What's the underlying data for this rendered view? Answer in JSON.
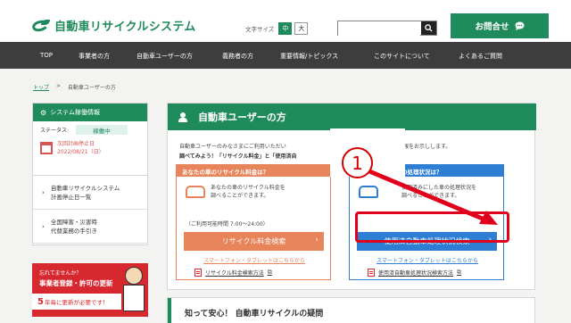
{
  "header": {
    "logo_text": "自動車リサイクルシステム",
    "fontsize_label": "文字サイズ",
    "fontsize_options": [
      "中",
      "大"
    ],
    "search_placeholder": "",
    "contact_label": "お問合せ"
  },
  "nav": {
    "items": [
      "TOP",
      "事業者の方",
      "自動車ユーザーの方",
      "義務者の方",
      "重要情報/トピックス",
      "このサイトについて",
      "よくあるご質問"
    ]
  },
  "breadcrumb": {
    "home": "トップ",
    "separator": ">",
    "current": "自動車ユーザーの方"
  },
  "sidebar": {
    "status_title": "システム稼働情報",
    "status_label": "ステータス:",
    "status_value": "稼働中",
    "maint_line1": "次回計画停止日",
    "maint_line2": "2022/08/21（日）",
    "links": [
      {
        "line1": "自動車リサイクルシステム",
        "line2": "計画停止日一覧"
      },
      {
        "line1": "全国障害・災害時",
        "line2": "代替業務の手引き"
      }
    ],
    "banner_small": "忘れてませんか？",
    "banner_big": "事業者登録・許可の更新",
    "banner_num": "5",
    "banner_strip": "年毎に更新が必要です！"
  },
  "main": {
    "title": "自動車ユーザーの方",
    "intro_part1": "自動車ユーザーのみなさまにご利用いただい",
    "intro_part2": "情報をお示しします。",
    "intro_bold": "調べてみよう！「リサイクル料金」と「使用済自",
    "card_left": {
      "heading": "あなたの車のリサイクル料金は？",
      "desc_line1": "あなたの車のリサイクル料金を",
      "desc_line2": "調べることができます。",
      "hours": "（ご利用可能時間 7:00～24:00）",
      "button": "リサイクル料金検索",
      "sp_link": "スマートフォン・タブレットはこちらから",
      "pdf_link": "リサイクル料金検索方法"
    },
    "card_right": {
      "heading": "の処理状況は？",
      "desc_line1": "使用済みにした車の処理状況を",
      "desc_line2": "調べることができます。",
      "button": "使用済自動車処理状況検索",
      "sp_link": "スマートフォン・タブレットはこちらから",
      "pdf_link": "使用済自動車処理状況検索方法"
    }
  },
  "annotation": {
    "number": "1"
  },
  "faq": {
    "title": "知って安心！ 自動車リサイクルの疑問"
  },
  "colors": {
    "brand_green": "#1f8a5c",
    "orange": "#e8845a",
    "blue": "#2e7fd4",
    "annotation_red": "#e0001b"
  }
}
